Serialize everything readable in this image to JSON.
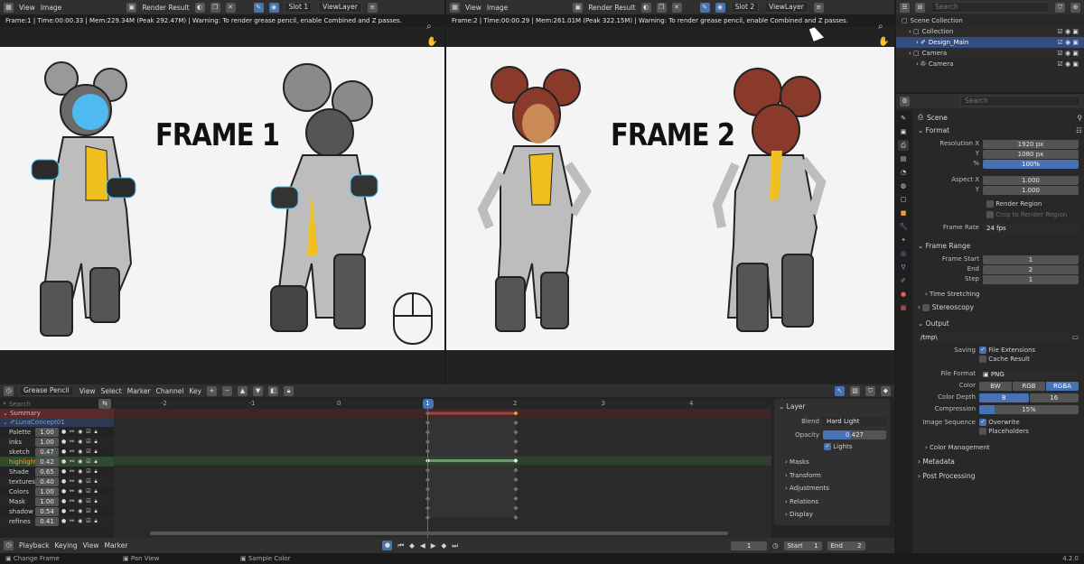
{
  "left_editor": {
    "menus": [
      "View",
      "Image"
    ],
    "image_name": "Render Result",
    "slot": "Slot 1",
    "view_layer": "ViewLayer",
    "info": "Frame:1 | Time:00:00.33 | Mem:229.34M (Peak 292.47M) | Warning: To render grease pencil, enable Combined and Z passes.",
    "frame_title": "FRAME 1"
  },
  "right_editor": {
    "menus": [
      "View",
      "Image"
    ],
    "image_name": "Render Result",
    "slot": "Slot 2",
    "view_layer": "ViewLayer",
    "info": "Frame:2 | Time:00:00.29 | Mem:261.01M (Peak 322.15M) | Warning: To render grease pencil, enable Combined and Z passes.",
    "frame_title": "FRAME 2"
  },
  "outliner": {
    "search_placeholder": "Search",
    "items": [
      {
        "label": "Scene Collection",
        "level": 0
      },
      {
        "label": "Collection",
        "level": 1
      },
      {
        "label": "Design_Main",
        "level": 2,
        "selected": true
      },
      {
        "label": "Camera",
        "level": 1
      },
      {
        "label": "Camera",
        "level": 2
      }
    ]
  },
  "dopesheet": {
    "mode": "Grease Pencil",
    "menus": [
      "View",
      "Select",
      "Marker",
      "Channel",
      "Key"
    ],
    "search_placeholder": "Search",
    "ruler": [
      "-2",
      "-1",
      "0",
      "1",
      "2",
      "3",
      "4"
    ],
    "current_frame": "1",
    "summary": "Summary",
    "object": "LunaConcept01",
    "layers": [
      {
        "name": "Palette",
        "opacity": "1.00"
      },
      {
        "name": "inks",
        "opacity": "1.00"
      },
      {
        "name": "sketch",
        "opacity": "0.47"
      },
      {
        "name": "highlight",
        "opacity": "0.42",
        "active": true
      },
      {
        "name": "Shade",
        "opacity": "0.65"
      },
      {
        "name": "textures",
        "opacity": "0.40"
      },
      {
        "name": "Colors",
        "opacity": "1.00"
      },
      {
        "name": "Mask",
        "opacity": "1.00"
      },
      {
        "name": "shadow",
        "opacity": "0.54"
      },
      {
        "name": "refines",
        "opacity": "0.41"
      }
    ]
  },
  "layer_panel": {
    "title": "Layer",
    "blend_label": "Blend",
    "blend_value": "Hard Light",
    "opacity_label": "Opacity",
    "opacity_value": "0.427",
    "opacity_fraction": 0.427,
    "lights_label": "Lights",
    "subpanels": [
      "Masks",
      "Transform",
      "Adjustments",
      "Relations",
      "Display"
    ]
  },
  "timeline": {
    "menus": [
      "Playback",
      "Keying",
      "View",
      "Marker"
    ],
    "frame": "1",
    "start_label": "Start",
    "start": "1",
    "end_label": "End",
    "end": "2"
  },
  "status": {
    "items": [
      "Change Frame",
      "Pan View",
      "Sample Color"
    ],
    "version": "4.2.0"
  },
  "properties": {
    "search_placeholder": "Search",
    "scene_label": "Scene",
    "format": {
      "title": "Format",
      "res_x_label": "Resolution X",
      "res_x": "1920 px",
      "res_y_label": "Y",
      "res_y": "1080 px",
      "pct_label": "%",
      "pct": "100%",
      "aspect_x_label": "Aspect X",
      "aspect_x": "1.000",
      "aspect_y_label": "Y",
      "aspect_y": "1.000",
      "render_region": "Render Region",
      "crop": "Crop to Render Region",
      "frame_rate_label": "Frame Rate",
      "frame_rate": "24 fps"
    },
    "frame_range": {
      "title": "Frame Range",
      "start_label": "Frame Start",
      "start": "1",
      "end_label": "End",
      "end": "2",
      "step_label": "Step",
      "step": "1",
      "time_stretching": "Time Stretching"
    },
    "stereoscopy": "Stereoscopy",
    "output": {
      "title": "Output",
      "path": "/tmp\\",
      "saving_label": "Saving",
      "file_ext": "File Extensions",
      "cache": "Cache Result",
      "file_format_label": "File Format",
      "file_format": "PNG",
      "color_label": "Color",
      "color_opts": [
        "BW",
        "RGB",
        "RGBA"
      ],
      "depth_label": "Color Depth",
      "depth_opts": [
        "8",
        "16"
      ],
      "compression_label": "Compression",
      "compression": "15%",
      "compression_fraction": 0.15,
      "img_seq_label": "Image Sequence",
      "overwrite": "Overwrite",
      "placeholders": "Placeholders",
      "color_management": "Color Management"
    },
    "metadata": "Metadata",
    "post_processing": "Post Processing"
  },
  "colors": {
    "accent": "#4772b3",
    "summary_bg": "#5a2a2a",
    "active_row": "#2f4a2f",
    "highlight_text": "#e8a040",
    "object_text": "#6ea0e6"
  }
}
